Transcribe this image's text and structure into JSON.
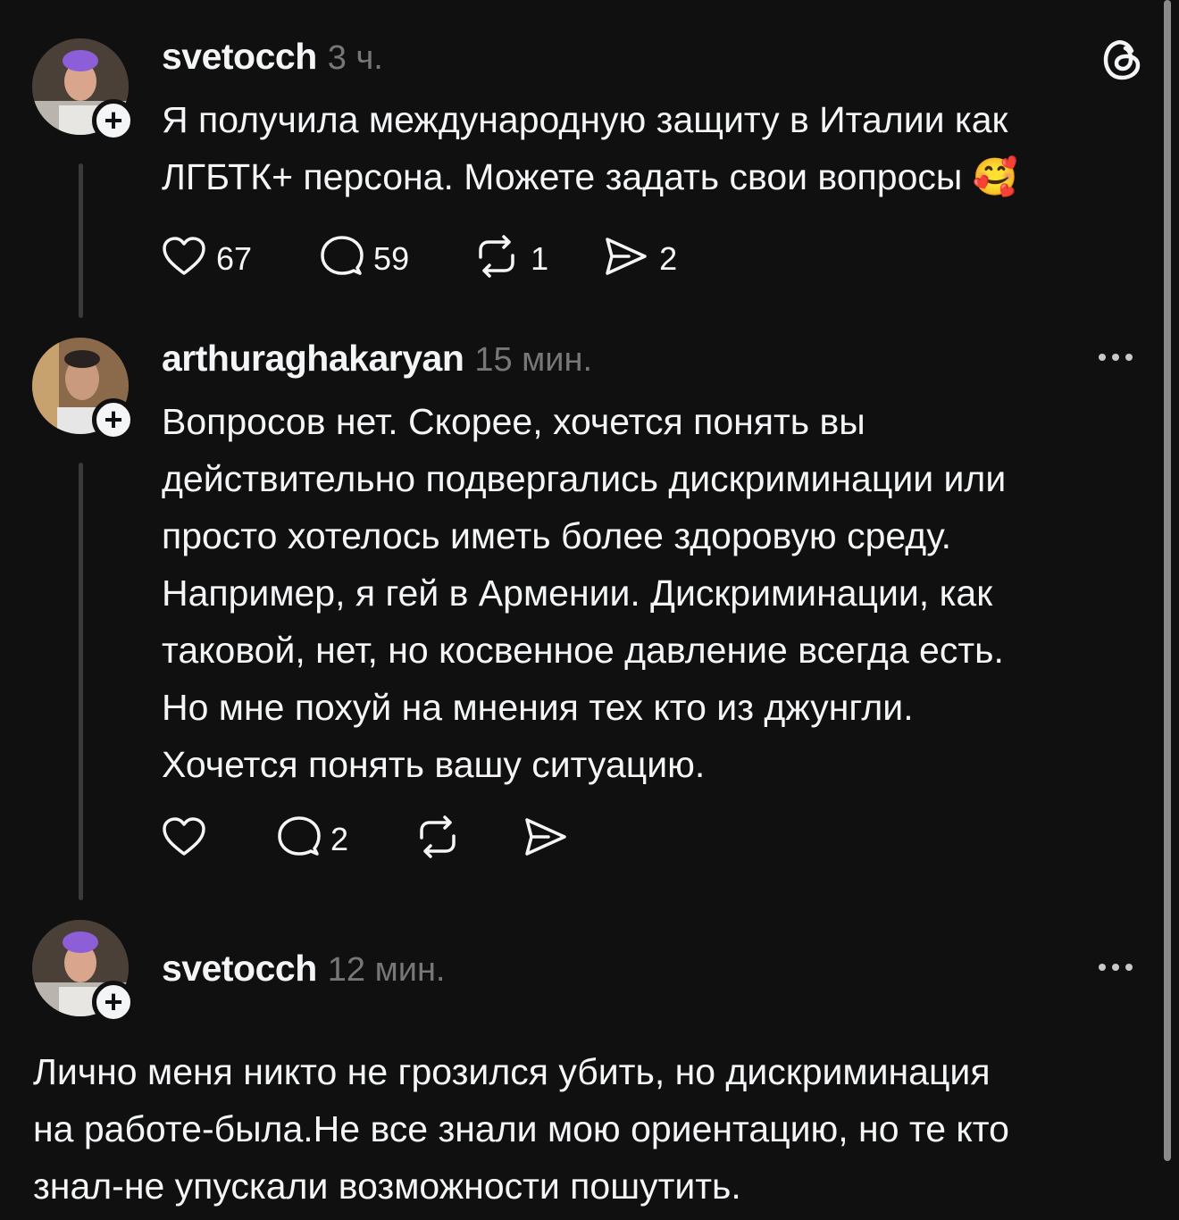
{
  "post": {
    "username": "svetocch",
    "time": "3 ч.",
    "text": "Я получила международную защиту в Италии как\nЛГБТК+ персона. Можете задать свои вопросы 🥰",
    "likes": "67",
    "comments": "59",
    "reposts": "1",
    "shares": "2"
  },
  "reply1": {
    "username": "arthuraghakaryan",
    "time": "15 мин.",
    "text": "Вопросов нет. Скорее, хочется понять вы\nдействительно подвергались дискриминации или\nпросто хотелось иметь более здоровую среду.\nНапример, я гей в Армении. Дискриминации, как\nтаковой, нет, но косвенное давление всегда есть.\nНо мне похуй на мнения тех кто из джунгли.\nХочется понять вашу ситуацию.",
    "comments": "2"
  },
  "reply2": {
    "username": "svetocch",
    "time": "12 мин.",
    "text": "Лично меня никто не грозился убить, но дискриминация\nна работе-была.Не все знали мою ориентацию, но те кто\nзнал-не упускали возможности пошутить."
  },
  "icons": {
    "app_logo": "threads-logo-icon",
    "like": "heart-icon",
    "comment": "comment-bubble-icon",
    "repost": "repost-icon",
    "share": "send-icon",
    "more": "more-dots-icon",
    "follow": "plus-icon"
  },
  "colors": {
    "background": "#101010",
    "text": "#f3f5f7",
    "muted": "#777777",
    "thread_line": "#3a3a3a"
  }
}
